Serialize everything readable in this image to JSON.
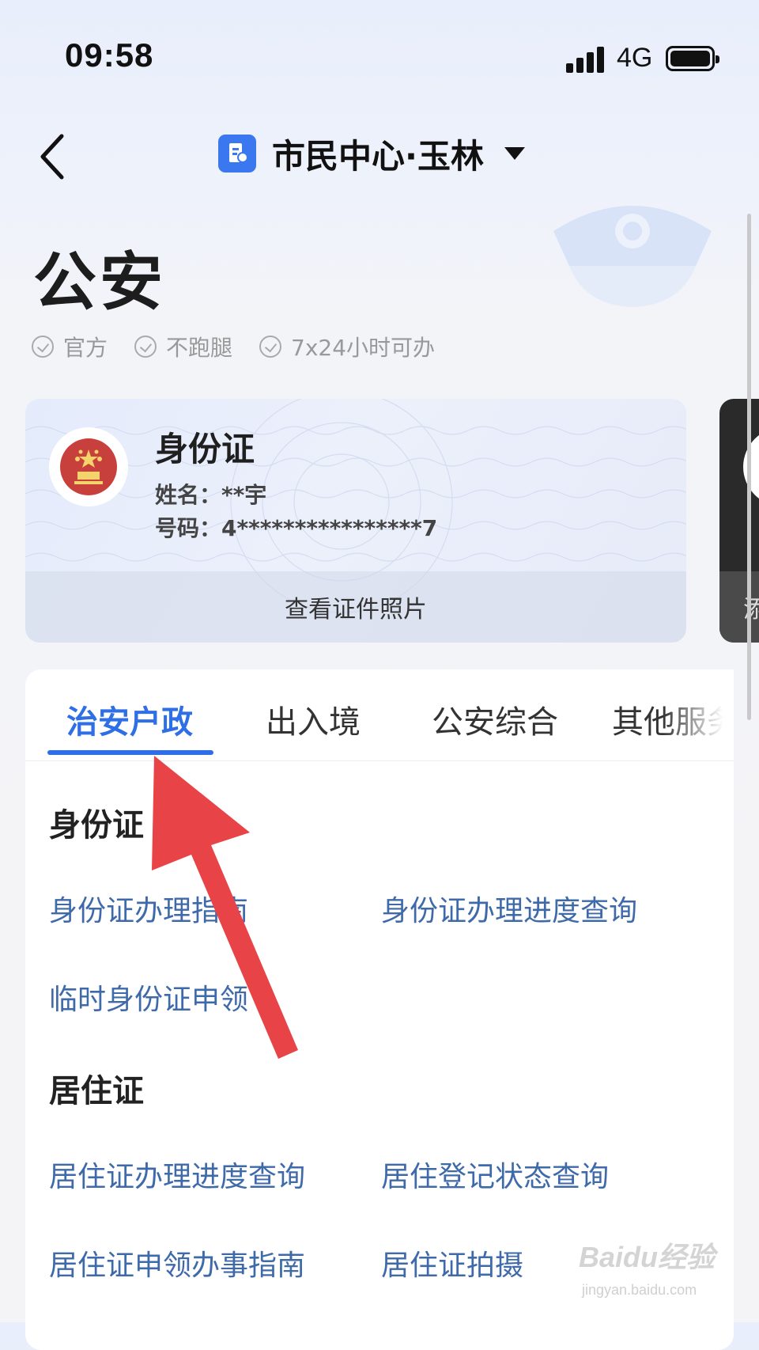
{
  "status_bar": {
    "time": "09:58",
    "network": "4G"
  },
  "nav": {
    "title": "市民中心·玉林"
  },
  "page": {
    "title": "公安",
    "features": [
      "官方",
      "不跑腿",
      "7x24小时可办"
    ]
  },
  "id_card": {
    "title": "身份证",
    "name": "姓名：**宇",
    "number": "号码：4****************7",
    "footer": "查看证件照片"
  },
  "next_card": {
    "footer_partial": "添"
  },
  "tabs": [
    {
      "label": "治安户政",
      "active": true
    },
    {
      "label": "出入境",
      "active": false
    },
    {
      "label": "公安综合",
      "active": false
    },
    {
      "label": "其他服务",
      "active": false
    }
  ],
  "sections": [
    {
      "title": "身份证",
      "items": [
        "身份证办理指南",
        "身份证办理进度查询",
        "临时身份证申领"
      ]
    },
    {
      "title": "居住证",
      "items": [
        "居住证办理进度查询",
        "居住登记状态查询",
        "居住证申领办事指南",
        "居住证拍摄"
      ]
    }
  ],
  "watermark": {
    "brand": "Baidu经验",
    "url": "jingyan.baidu.com"
  },
  "colors": {
    "accent": "#2f6fe6",
    "link": "#3f6aa9",
    "arrow": "#e84346"
  }
}
